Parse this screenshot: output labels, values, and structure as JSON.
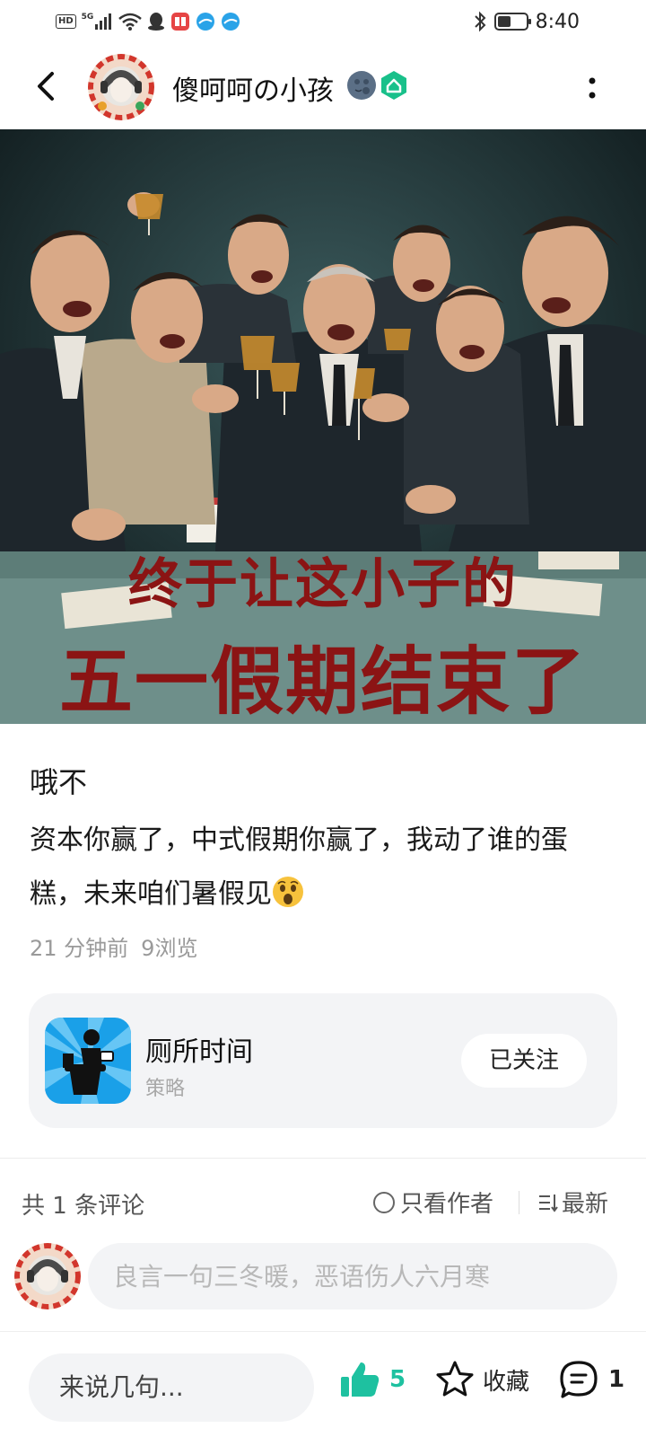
{
  "status_bar": {
    "network": "HD",
    "signal": "5G",
    "time": "8:40",
    "battery_level": 0.45,
    "icons": [
      "hd-icon",
      "signal-icon",
      "wifi-icon",
      "qq-icon",
      "app-icon",
      "browser-icon",
      "browser-icon",
      "bluetooth-icon",
      "battery-icon"
    ]
  },
  "header": {
    "author_name": "傻呵呵の小孩",
    "icons": [
      "back-icon",
      "avatar",
      "moon-emoji-icon",
      "verified-badge-icon",
      "more-icon"
    ]
  },
  "post": {
    "image_caption_line1": "终于让这小子的",
    "image_caption_line2": "五一假期结束了",
    "title": "哦不",
    "body": "资本你赢了，中式假期你赢了，我动了谁的蛋糕，未来咱们暑假见",
    "time_ago": "21 分钟前",
    "views": "9浏览"
  },
  "game_card": {
    "name": "厕所时间",
    "genre": "策略",
    "follow_label": "已关注"
  },
  "comments": {
    "count_label": "共 1 条评论",
    "author_only_label": "只看作者",
    "sort_label": "最新",
    "reply_placeholder": "良言一句三冬暖，恶语伤人六月寒"
  },
  "bottom_bar": {
    "say_placeholder": "来说几句...",
    "likes": "5",
    "favorite_label": "收藏",
    "comments": "1"
  },
  "colors": {
    "accent": "#1ec1a0",
    "card_bg": "#f3f4f6",
    "caption_red": "#8b1414"
  }
}
